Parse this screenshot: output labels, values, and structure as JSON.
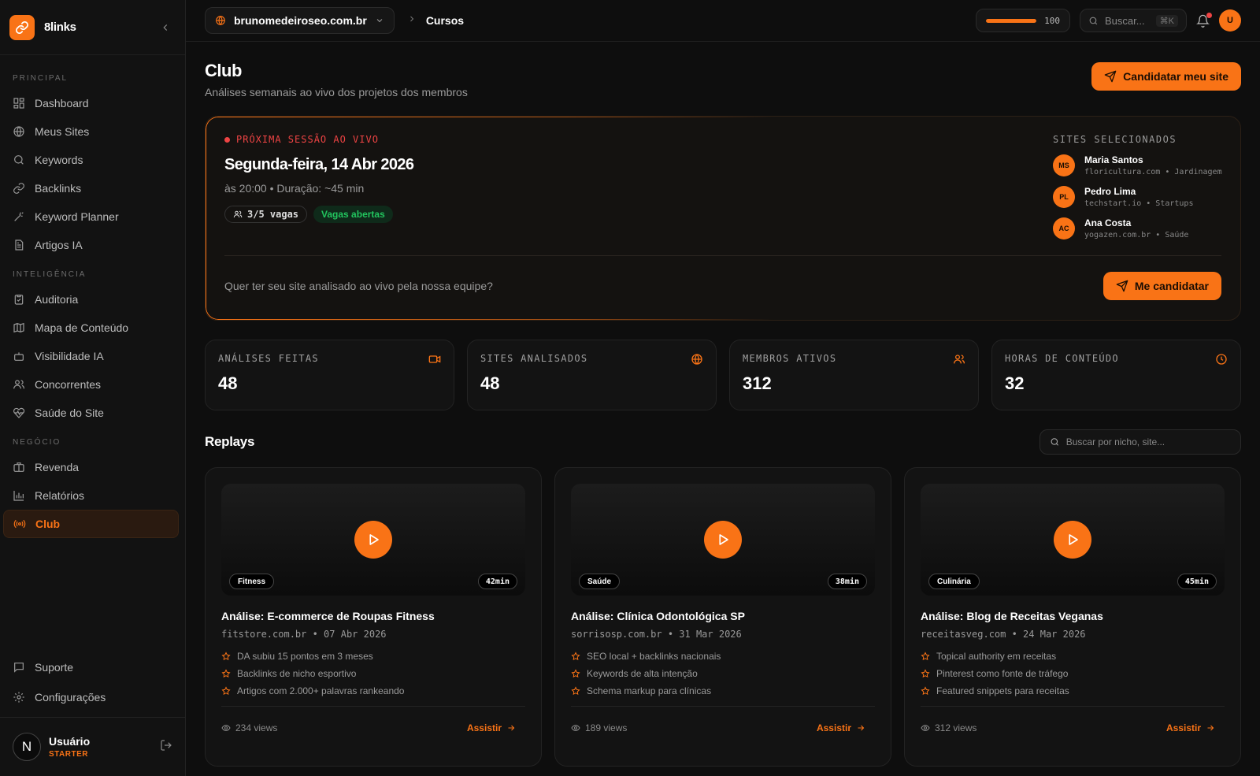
{
  "brand": {
    "name": "8links"
  },
  "sidebar": {
    "sections": [
      {
        "title": "PRINCIPAL",
        "items": [
          "Dashboard",
          "Meus Sites",
          "Keywords",
          "Backlinks",
          "Keyword Planner",
          "Artigos IA"
        ]
      },
      {
        "title": "INTELIGÊNCIA",
        "items": [
          "Auditoria",
          "Mapa de Conteúdo",
          "Visibilidade IA",
          "Concorrentes",
          "Saúde do Site"
        ]
      },
      {
        "title": "NEGÓCIO",
        "items": [
          "Revenda",
          "Relatórios",
          "Club"
        ]
      }
    ],
    "bottom_items": [
      "Suporte",
      "Configurações"
    ],
    "user": {
      "initial": "N",
      "name": "Usuário",
      "plan": "STARTER"
    }
  },
  "topbar": {
    "site": "brunomedeiroseo.com.br",
    "breadcrumb": "Cursos",
    "credits": 100,
    "credits_fraction": 1.0,
    "search_placeholder": "Buscar...",
    "search_shortcut": "⌘K",
    "user_initial": "U"
  },
  "page": {
    "title": "Club",
    "subtitle": "Análises semanais ao vivo dos projetos dos membros",
    "cta": "Candidatar meu site"
  },
  "session": {
    "label": "PRÓXIMA SESSÃO AO VIVO",
    "date": "Segunda-feira, 14 Abr 2026",
    "time": "às 20:00 • Duração: ~45 min",
    "vagas": "3/5 vagas",
    "status": "Vagas abertas",
    "selected_title": "SITES SELECIONADOS",
    "selected": [
      {
        "initials": "MS",
        "name": "Maria Santos",
        "meta": "floricultura.com • Jardinagem"
      },
      {
        "initials": "PL",
        "name": "Pedro Lima",
        "meta": "techstart.io • Startups"
      },
      {
        "initials": "AC",
        "name": "Ana Costa",
        "meta": "yogazen.com.br • Saúde"
      }
    ],
    "question": "Quer ter seu site analisado ao vivo pela nossa equipe?",
    "apply": "Me candidatar"
  },
  "stats": [
    {
      "label": "ANÁLISES FEITAS",
      "value": "48",
      "icon": "video-icon"
    },
    {
      "label": "SITES ANALISADOS",
      "value": "48",
      "icon": "globe-icon"
    },
    {
      "label": "MEMBROS ATIVOS",
      "value": "312",
      "icon": "users-icon"
    },
    {
      "label": "HORAS DE CONTEÚDO",
      "value": "32",
      "icon": "clock-icon"
    }
  ],
  "replays": {
    "title": "Replays",
    "search_placeholder": "Buscar por nicho, site...",
    "cards": [
      {
        "niche": "Fitness",
        "duration": "42min",
        "title": "Análise: E-commerce de Roupas Fitness",
        "meta": "fitstore.com.br • 07 Abr 2026",
        "points": [
          "DA subiu 15 pontos em 3 meses",
          "Backlinks de nicho esportivo",
          "Artigos com 2.000+ palavras rankeando"
        ],
        "views": "234 views",
        "watch": "Assistir"
      },
      {
        "niche": "Saúde",
        "duration": "38min",
        "title": "Análise: Clínica Odontológica SP",
        "meta": "sorrisosp.com.br • 31 Mar 2026",
        "points": [
          "SEO local + backlinks nacionais",
          "Keywords de alta intenção",
          "Schema markup para clínicas"
        ],
        "views": "189 views",
        "watch": "Assistir"
      },
      {
        "niche": "Culinária",
        "duration": "45min",
        "title": "Análise: Blog de Receitas Veganas",
        "meta": "receitasveg.com • 24 Mar 2026",
        "points": [
          "Topical authority em receitas",
          "Pinterest como fonte de tráfego",
          "Featured snippets para receitas"
        ],
        "views": "312 views",
        "watch": "Assistir"
      }
    ]
  },
  "colors": {
    "accent": "#f97316",
    "live": "#ef4444",
    "success": "#22c55e"
  }
}
